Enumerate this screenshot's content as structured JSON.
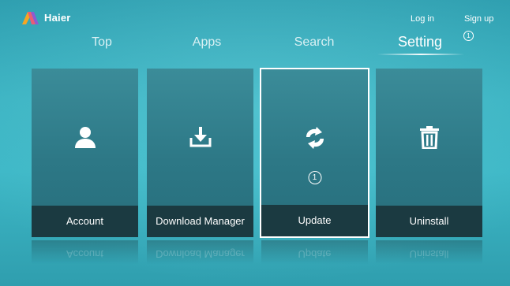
{
  "brand": {
    "name": "Haier",
    "logo_icon": "haier-logo-icon",
    "colors": [
      "#f39c12",
      "#e74c3c",
      "#8e44ad"
    ]
  },
  "account_links": {
    "login": "Log in",
    "signup": "Sign up"
  },
  "notification_badge": "1",
  "nav": {
    "tabs": [
      "Top",
      "Apps",
      "Search",
      "Setting"
    ],
    "active": "Setting"
  },
  "tiles": [
    {
      "label": "Account",
      "icon": "user-icon"
    },
    {
      "label": "Download Manager",
      "icon": "download-icon"
    },
    {
      "label": "Update",
      "icon": "refresh-icon",
      "badge": "1",
      "focused": true
    },
    {
      "label": "Uninstall",
      "icon": "trash-icon"
    }
  ],
  "colors": {
    "background": "#3bb3c2",
    "tile": "#2d7886",
    "label_bar": "#1b3a41",
    "focus_border": "#ffffff"
  }
}
